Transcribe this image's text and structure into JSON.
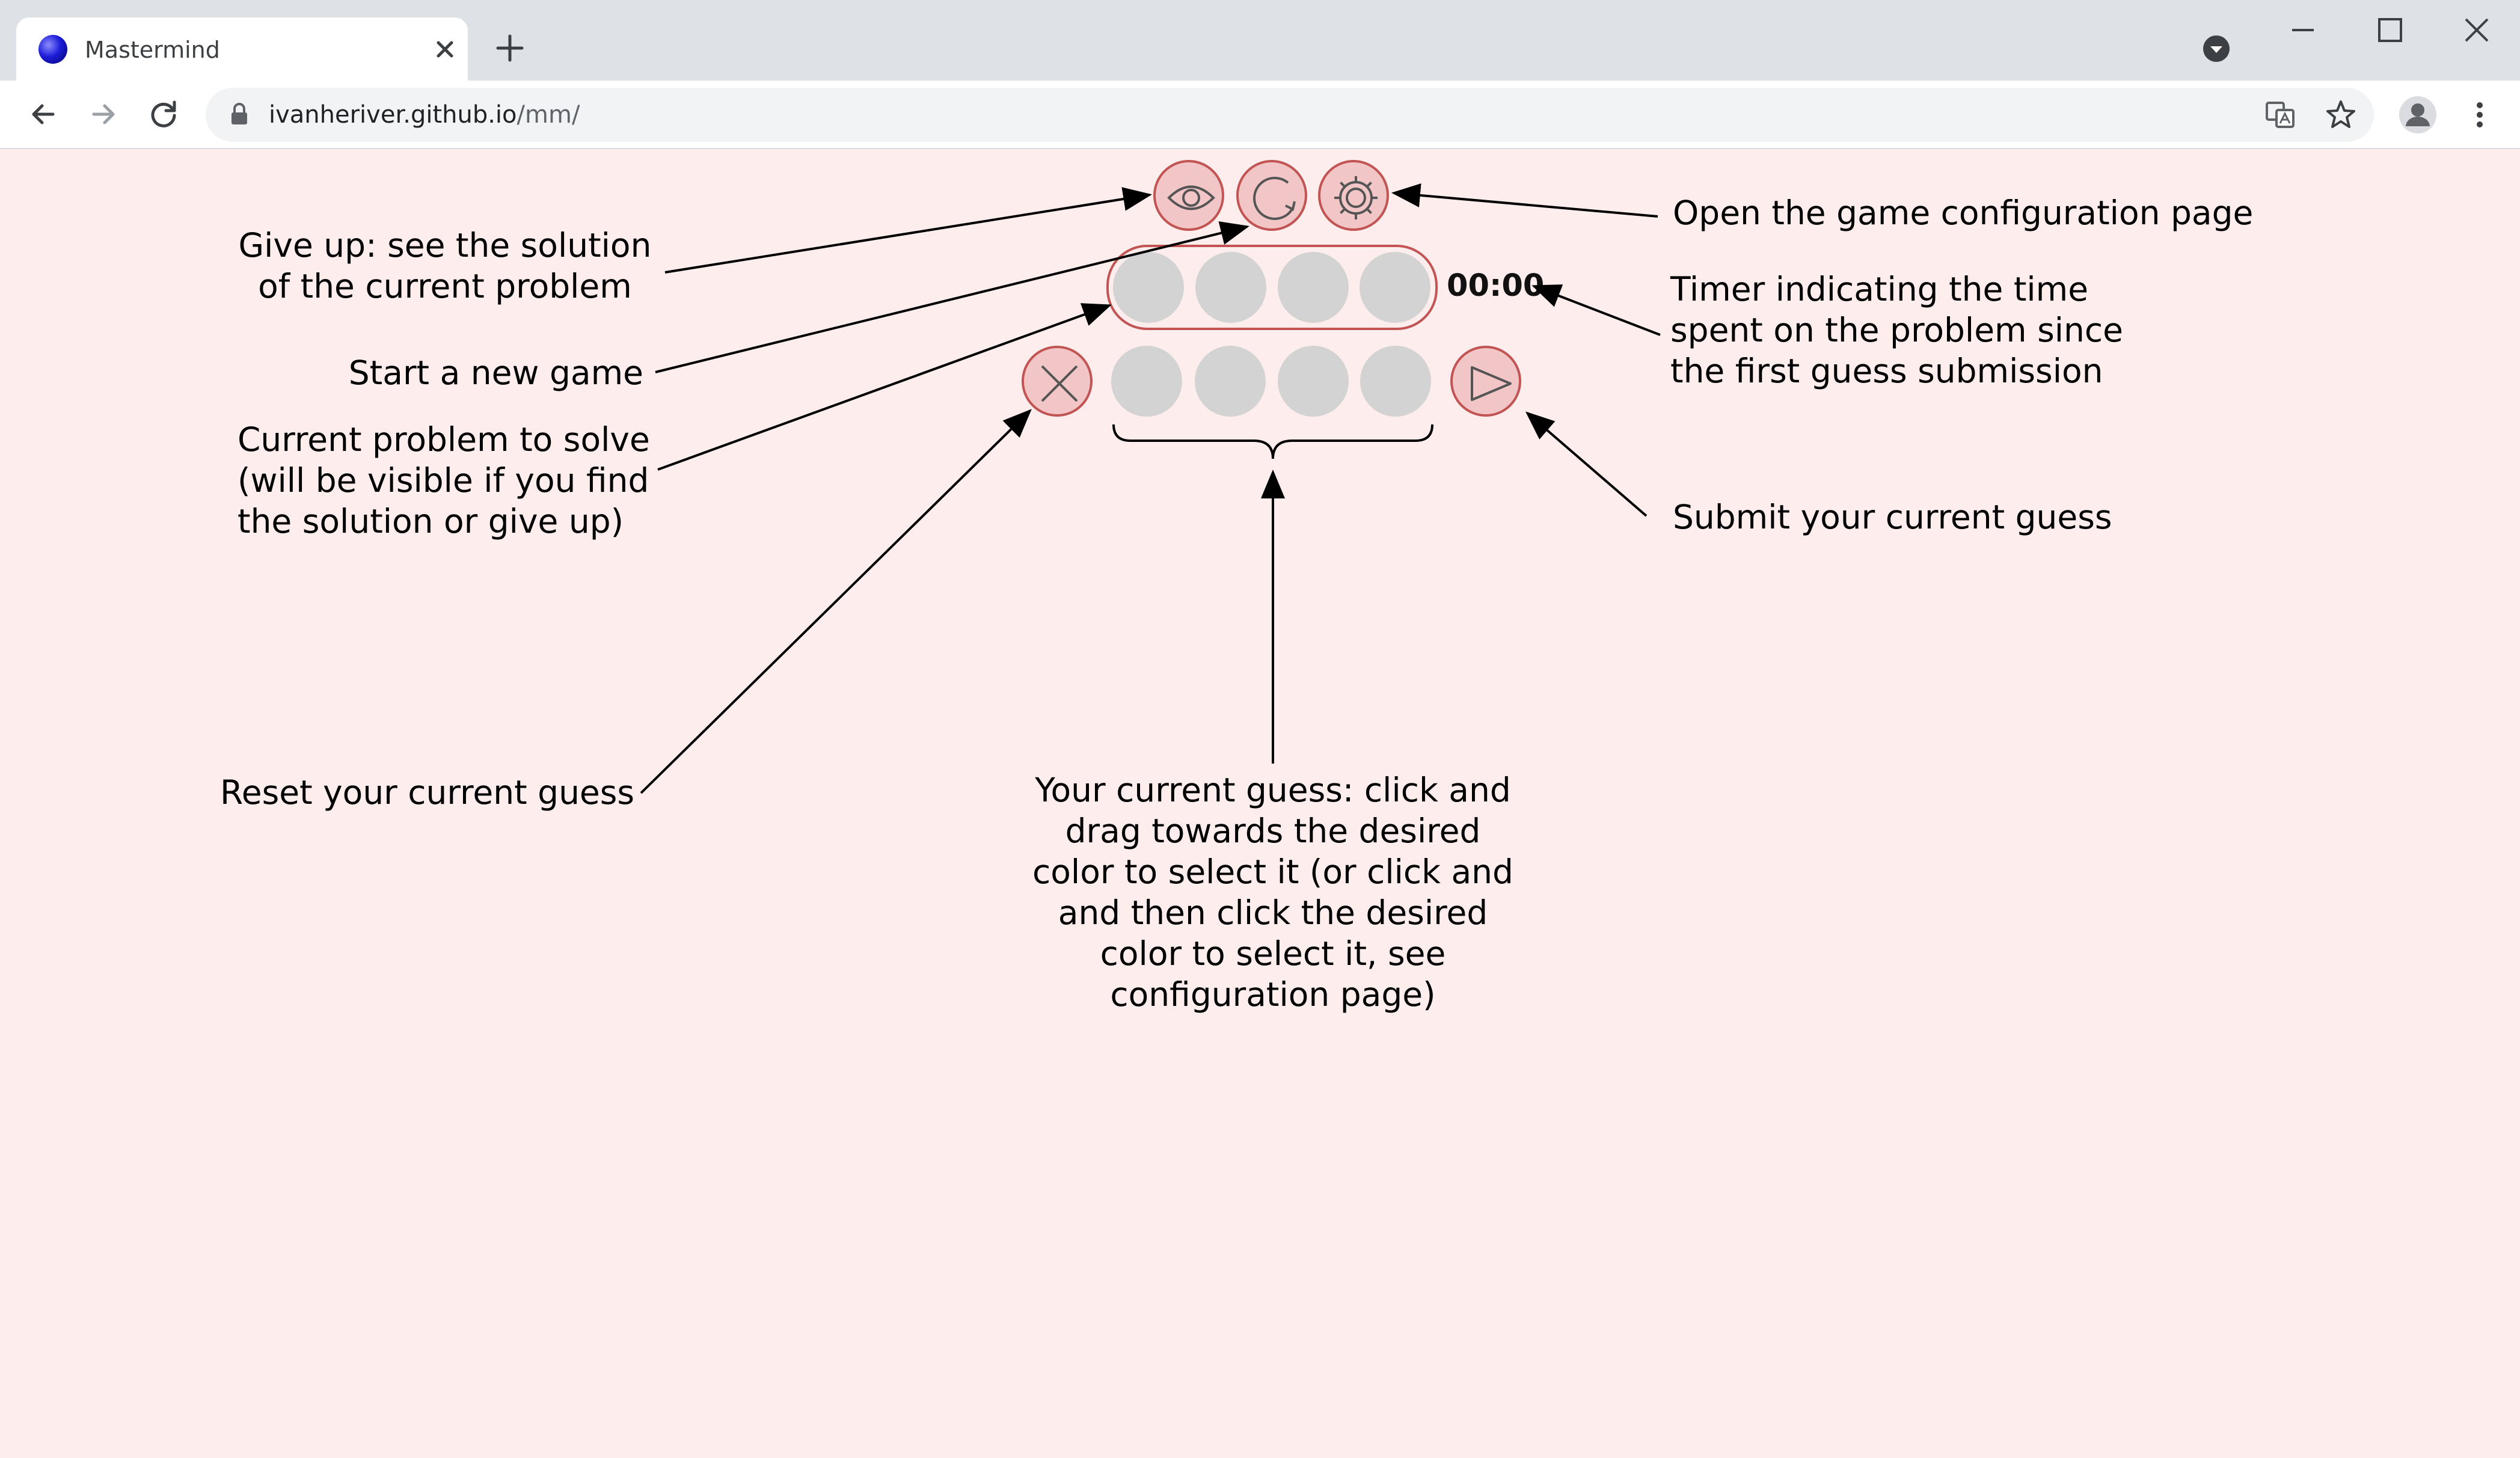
{
  "browser": {
    "tab_title": "Mastermind",
    "url_host": "ivanheriver.github.io",
    "url_path": "/mm/"
  },
  "game": {
    "timer": "00:00",
    "peg_color": "#d3d3d3",
    "button_fill": "#f2c6c6",
    "button_border": "#c25454",
    "background": "#fdeeed",
    "icons": {
      "give_up": "eye-icon",
      "new_game": "refresh-icon",
      "settings": "gear-icon",
      "reset": "x-icon",
      "submit": "play-icon"
    }
  },
  "annotations": {
    "give_up": "Give up: see the solution\nof the current problem",
    "new_game": "Start a new game",
    "current_problem": "Current problem to solve\n(will be visible if you find\nthe solution or give up)",
    "reset": "Reset your current guess",
    "config": "Open the game configuration page",
    "timer": "Timer indicating the time\nspent on the problem since\nthe first guess submission",
    "submit": "Submit your current guess",
    "current_guess": "Your current guess: click and\ndrag towards the desired\ncolor to select it (or click and\nand then click the desired\ncolor to select it, see\nconfiguration page)"
  }
}
